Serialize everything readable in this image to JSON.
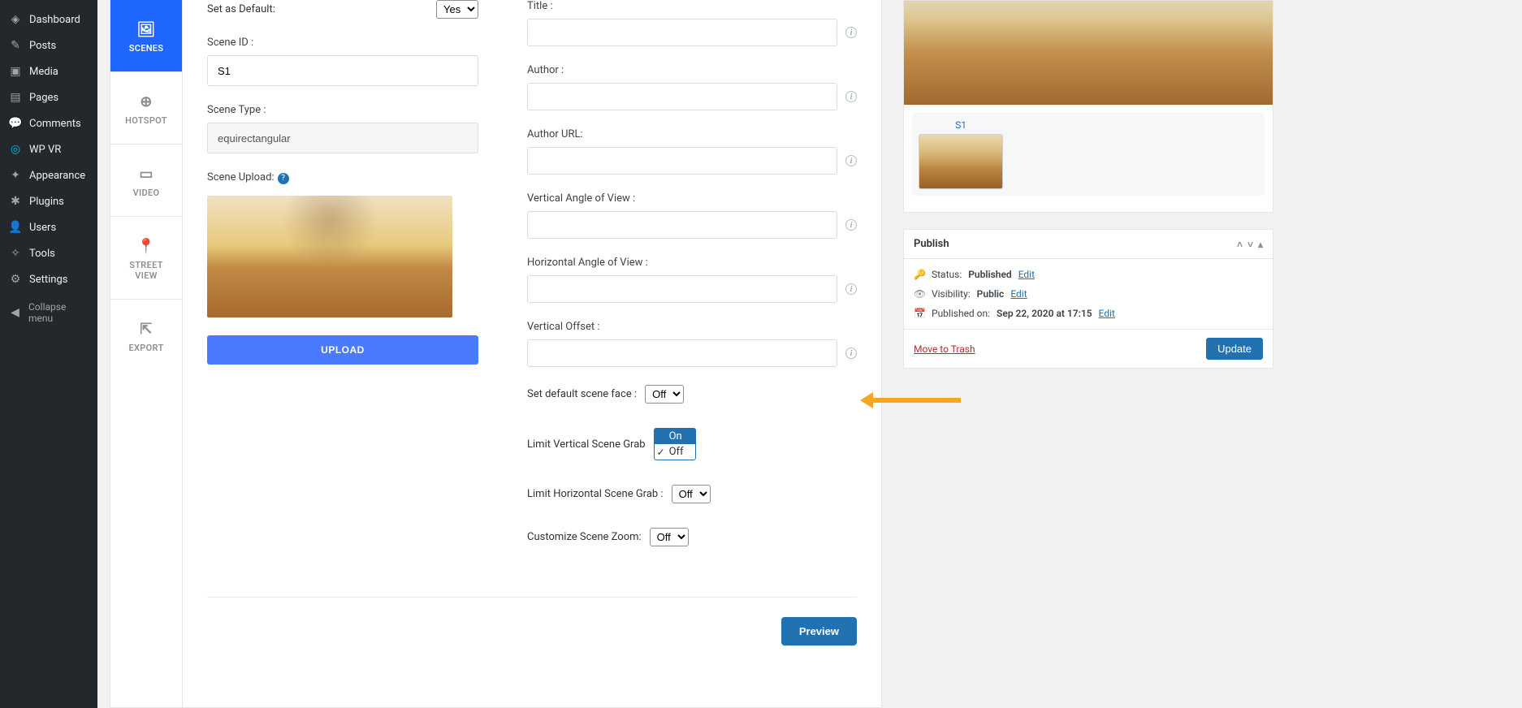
{
  "admin_menu": {
    "items": [
      {
        "label": "Dashboard",
        "icon": "◈"
      },
      {
        "label": "Posts",
        "icon": "✎"
      },
      {
        "label": "Media",
        "icon": "▣"
      },
      {
        "label": "Pages",
        "icon": "▤"
      },
      {
        "label": "Comments",
        "icon": "💬"
      },
      {
        "label": "WP VR",
        "icon": "◎"
      },
      {
        "label": "Appearance",
        "icon": "✦"
      },
      {
        "label": "Plugins",
        "icon": "✱"
      },
      {
        "label": "Users",
        "icon": "👤"
      },
      {
        "label": "Tools",
        "icon": "✧"
      },
      {
        "label": "Settings",
        "icon": "⚙"
      }
    ],
    "collapse": "Collapse menu"
  },
  "tabs": [
    {
      "label": "SCENES",
      "icon": "🖼"
    },
    {
      "label": "HOTSPOT",
      "icon": "⊕"
    },
    {
      "label": "VIDEO",
      "icon": "▭"
    },
    {
      "label": "STREET",
      "sub": "VIEW",
      "icon": "📍"
    },
    {
      "label": "EXPORT",
      "icon": "⇱"
    }
  ],
  "left_form": {
    "set_default_label": "Set as Default:",
    "set_default_value": "Yes",
    "scene_id_label": "Scene ID :",
    "scene_id_value": "S1",
    "scene_type_label": "Scene Type :",
    "scene_type_value": "equirectangular",
    "scene_upload_label": "Scene Upload:",
    "upload_btn": "UPLOAD"
  },
  "right_form": {
    "title_label": "Title :",
    "author_label": "Author :",
    "author_url_label": "Author URL:",
    "vaov_label": "Vertical Angle of View :",
    "haov_label": "Horizontal Angle of View :",
    "voffset_label": "Vertical Offset :",
    "default_face_label": "Set default scene face :",
    "default_face_value": "Off",
    "dropdown_opts": {
      "on": "On",
      "off": "Off"
    },
    "limit_v_label": "Limit Vertical Scene Grab",
    "limit_h_label": "Limit Horizontal Scene Grab :",
    "limit_h_value": "Off",
    "zoom_label": "Customize Scene Zoom:",
    "zoom_value": "Off"
  },
  "preview_btn": "Preview",
  "scenes_list": {
    "s1": "S1"
  },
  "publish": {
    "heading": "Publish",
    "status_label": "Status:",
    "status_value": "Published",
    "edit": "Edit",
    "visibility_label": "Visibility:",
    "visibility_value": "Public",
    "published_label": "Published on:",
    "published_value": "Sep 22, 2020 at 17:15",
    "trash": "Move to Trash",
    "update": "Update"
  }
}
